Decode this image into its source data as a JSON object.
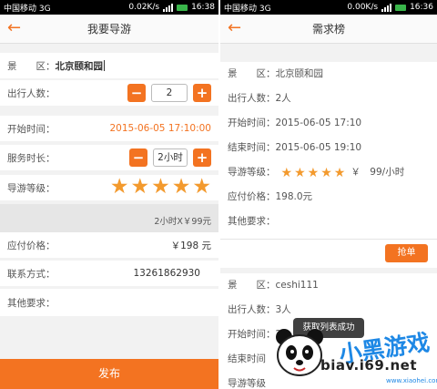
{
  "left": {
    "status": {
      "carrier": "中国移动 3G",
      "speed": "0.02K/s",
      "time": "16:38"
    },
    "header": {
      "title": "我要导游"
    },
    "spot": {
      "label": "景　　区：",
      "value": "北京颐和园"
    },
    "people": {
      "label": "出行人数：",
      "minus": "−",
      "value": "2",
      "plus": "+"
    },
    "start_time": {
      "label": "开始时间：",
      "value": "2015-06-05 17:10:00"
    },
    "duration": {
      "label": "服务时长：",
      "minus": "−",
      "value": "2小时",
      "plus": "+"
    },
    "level": {
      "label": "导游等级：",
      "stars": 5
    },
    "calc": "2小时X￥99元",
    "price": {
      "label": "应付价格：",
      "value": "￥198 元"
    },
    "contact": {
      "label": "联系方式：",
      "value": "13261862930"
    },
    "other": {
      "label": "其他要求："
    },
    "submit": "发布",
    "accent": "#f37321"
  },
  "right": {
    "status": {
      "carrier": "中国移动 3G",
      "speed": "0.00K/s",
      "time": "16:36"
    },
    "header": {
      "title": "需求榜"
    },
    "card1": {
      "spot": "景　　区：北京颐和园",
      "people": "出行人数：2人",
      "start": "开始时间：2015-06-05 17:10",
      "end": "结束时间：2015-06-05 19:10",
      "level_label": "导游等级：",
      "level_stars": 5,
      "rate": "￥　99/小时",
      "price": "应付价格：198.0元",
      "other": "其他要求：",
      "grab": "抢单"
    },
    "card2": {
      "spot": "景　　区：ceshi111",
      "people": "出行人数：3人",
      "start": "开始时间：2",
      "end": "结束时间",
      "level": "导游等级"
    },
    "toast": "获取列表成功"
  },
  "watermark": {
    "url": "biav.i69.net",
    "logo": "小黑游戏",
    "sub": "www.xiaohei.com"
  }
}
